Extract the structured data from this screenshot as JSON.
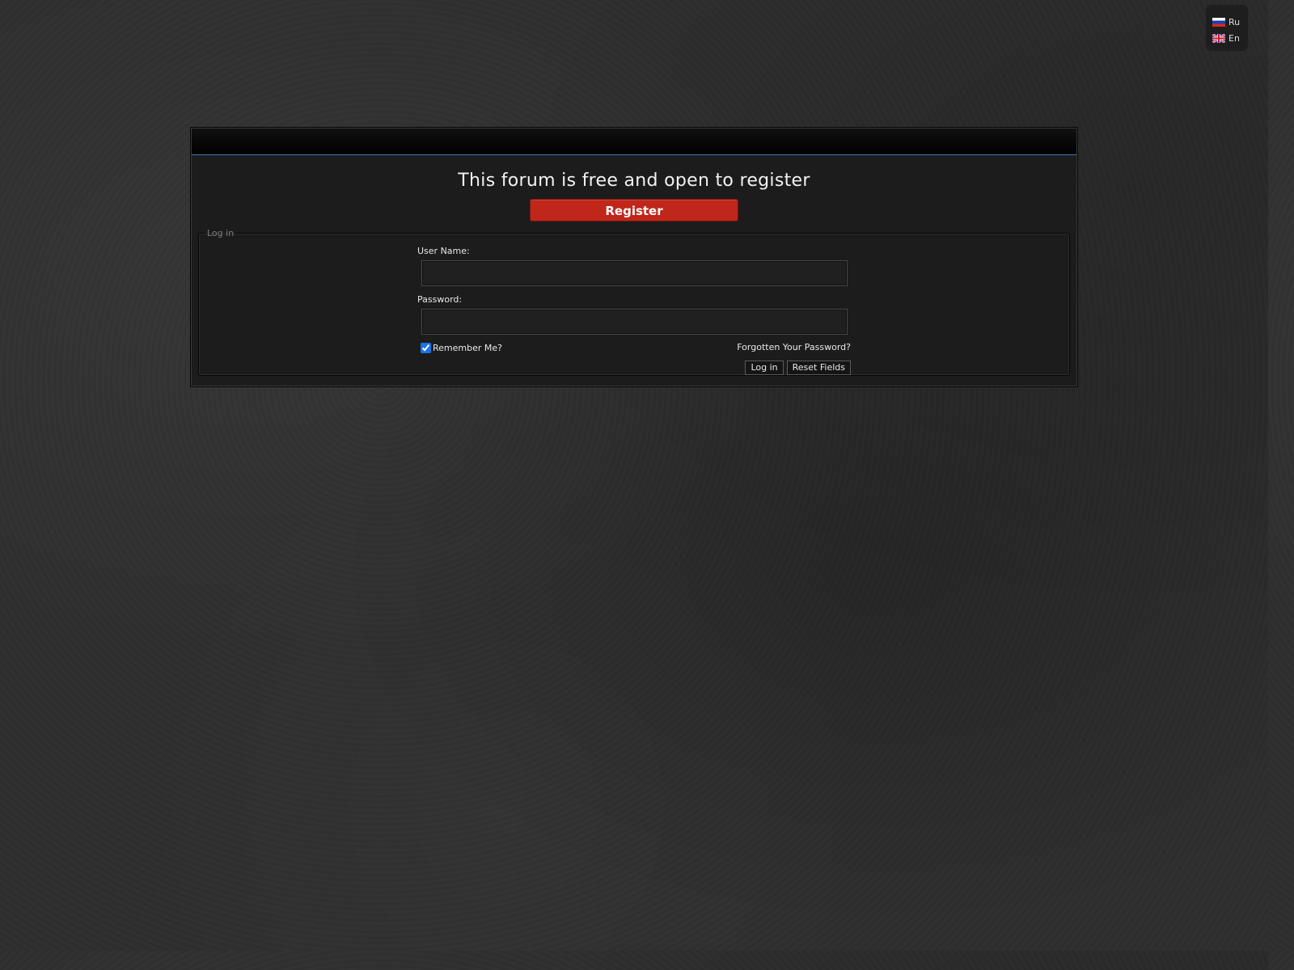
{
  "languages": [
    {
      "code": "Ru",
      "flag_icon": "russia-flag-icon"
    },
    {
      "code": "En",
      "flag_icon": "uk-flag-icon"
    }
  ],
  "headline": "This forum is free and open to register",
  "register": {
    "label": "Register",
    "color": "#c0261a"
  },
  "login": {
    "legend": "Log in",
    "username_label": "User Name:",
    "username_value": "",
    "password_label": "Password:",
    "password_value": "",
    "remember_label": "Remember Me?",
    "remember_checked": true,
    "forgot_label": "Forgotten Your Password?",
    "login_button": "Log in",
    "reset_button": "Reset Fields"
  },
  "colors": {
    "header_accent": "#3f7fb2",
    "panel_background": "#1c1c1c"
  }
}
